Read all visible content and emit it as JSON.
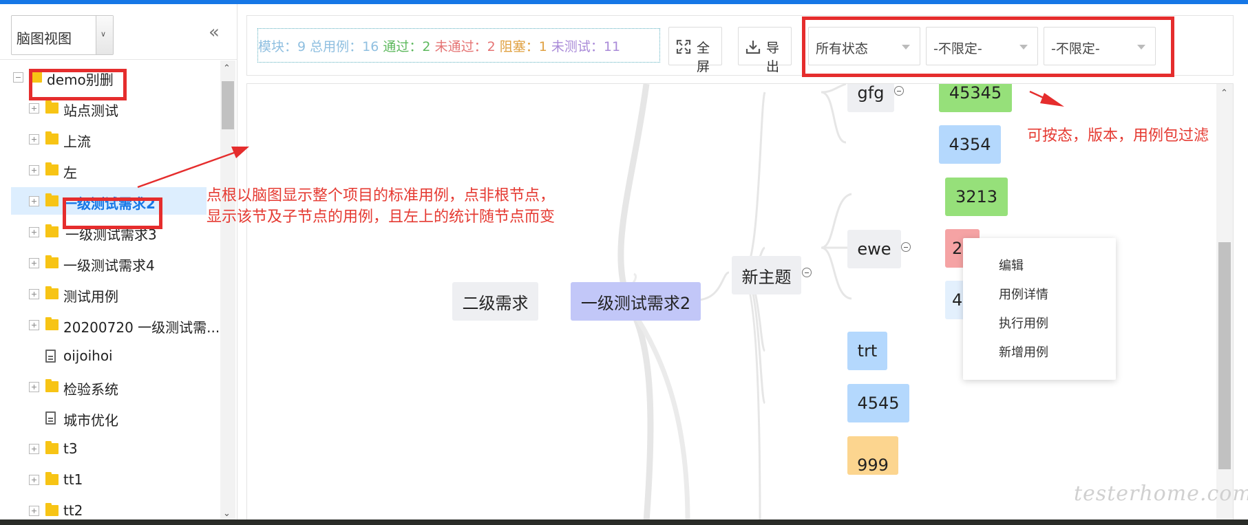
{
  "colors": {
    "accent": "#1677e6",
    "annotation": "#e52d2d"
  },
  "sidebar": {
    "view_select": "脑图视图",
    "collapse_icon": "double-chevron-left-icon",
    "tree": [
      {
        "label": "demo别删",
        "type": "folder",
        "expanded": true,
        "level": 0
      },
      {
        "label": "站点测试",
        "type": "folder",
        "level": 1
      },
      {
        "label": "上流",
        "type": "folder",
        "level": 1
      },
      {
        "label": "左",
        "type": "folder",
        "level": 1
      },
      {
        "label": "一级测试需求2",
        "type": "folder",
        "level": 1,
        "selected": true
      },
      {
        "label": "一级测试需求3",
        "type": "folder",
        "level": 1
      },
      {
        "label": "一级测试需求4",
        "type": "folder",
        "level": 1
      },
      {
        "label": "测试用例",
        "type": "folder",
        "level": 1
      },
      {
        "label": "20200720 一级测试需...",
        "type": "folder",
        "level": 1
      },
      {
        "label": "oijoihoi",
        "type": "file",
        "level": 1
      },
      {
        "label": "检验系统",
        "type": "folder",
        "level": 1
      },
      {
        "label": "城市优化",
        "type": "file",
        "level": 1
      },
      {
        "label": "t3",
        "type": "folder",
        "level": 1
      },
      {
        "label": "tt1",
        "type": "folder",
        "level": 1
      },
      {
        "label": "tt2",
        "type": "folder",
        "level": 1
      }
    ]
  },
  "toolbar": {
    "stats": [
      {
        "label": "模块：",
        "value": "9",
        "color": "#8fbfe0"
      },
      {
        "label": "总用例：",
        "value": "16",
        "color": "#8fbfe0"
      },
      {
        "label": "通过：",
        "value": "2",
        "color": "#5cb85c"
      },
      {
        "label": "未通过：",
        "value": "2",
        "color": "#e57373"
      },
      {
        "label": "阻塞：",
        "value": "1",
        "color": "#e0a040"
      },
      {
        "label": "未测试：",
        "value": "11",
        "color": "#a98ad8"
      }
    ],
    "fullscreen_label": "全屏",
    "export_label": "导出",
    "status_filter": "所有状态",
    "version_filter": "-不限定-",
    "package_filter": "-不限定-"
  },
  "mindmap": {
    "nodes": {
      "parent": "二级需求",
      "root": "一级测试需求2",
      "topic": "新主题",
      "gfg": "gfg",
      "ewe": "ewe",
      "trt": "trt",
      "n4545": "4545",
      "n45345": "45345",
      "n4354": "4354",
      "n3213": "3213",
      "n2": "2",
      "n4": "4",
      "bottom": "999"
    },
    "context_menu": [
      "编辑",
      "用例详情",
      "执行用例",
      "新增用例"
    ]
  },
  "annotations": {
    "tree_note_line1": "点根以脑图显示整个项目的标准用例，点非根节点，",
    "tree_note_line2": "显示该节及子节点的用例，且左上的统计随节点而变",
    "filter_note": "可按态，版本，用例包过滤"
  },
  "watermark": "testerhome.com"
}
